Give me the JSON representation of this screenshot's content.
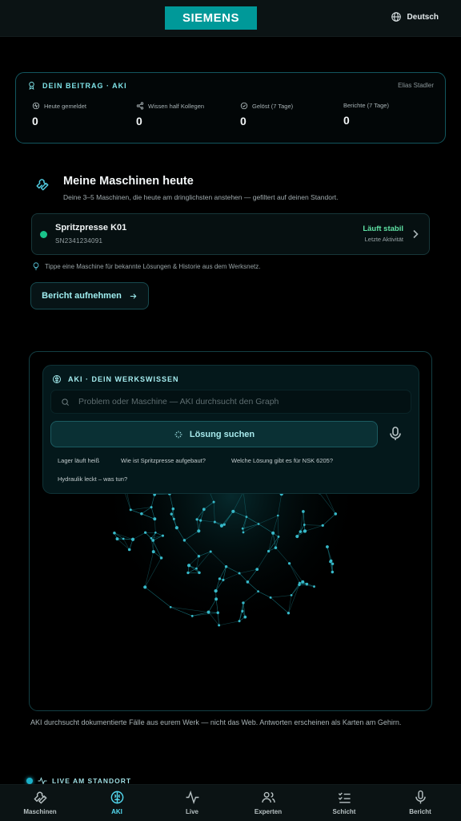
{
  "header": {
    "brand": "SIEMENS",
    "language": "Deutsch"
  },
  "contribution": {
    "title": "DEIN BEITRAG · AKI",
    "user": "Elias Stadler",
    "stats": [
      {
        "label": "Heute gemeldet",
        "value": "0",
        "icon": "heartbeat-icon"
      },
      {
        "label": "Wissen half Kollegen",
        "value": "0",
        "icon": "share-icon"
      },
      {
        "label": "Gelöst (7 Tage)",
        "value": "0",
        "icon": "check-circle-icon"
      },
      {
        "label": "Berichte (7 Tage)",
        "value": "0",
        "icon": "none"
      }
    ]
  },
  "machines": {
    "title": "Meine Maschinen heute",
    "subtitle": "Deine 3–5 Maschinen, die heute am dringlichsten anstehen — gefiltert auf deinen Standort.",
    "items": [
      {
        "name": "Spritzpresse K01",
        "serial": "SN2341234091",
        "status": "Läuft stabil",
        "last_activity": "Letzte Aktivität",
        "status_color": "#19c38a"
      }
    ],
    "tip": "Tippe eine Maschine für bekannte Lösungen & Historie aus dem Werksnetz.",
    "report_button": "Bericht aufnehmen"
  },
  "aki": {
    "title": "AKI · DEIN WERKSWISSEN",
    "search_placeholder": "Problem oder Maschine — AKI durchsucht den Graph",
    "solve_button": "Lösung suchen",
    "suggestions": [
      "Lager läuft heiß",
      "Wie ist Spritzpresse aufgebaut?",
      "Welche Lösung gibt es für NSK 6205?",
      "Hydraulik leckt – was tun?"
    ],
    "note": "AKI durchsucht dokumentierte Fälle aus eurem Werk — nicht das Web. Antworten erscheinen als Karten am Gehirn."
  },
  "live": {
    "label": "LIVE AM STANDORT"
  },
  "nav": {
    "items": [
      {
        "label": "Maschinen",
        "icon": "wrench-icon"
      },
      {
        "label": "AKI",
        "icon": "brain-icon",
        "active": true
      },
      {
        "label": "Live",
        "icon": "pulse-icon"
      },
      {
        "label": "Experten",
        "icon": "users-icon"
      },
      {
        "label": "Schicht",
        "icon": "checklist-icon"
      },
      {
        "label": "Bericht",
        "icon": "mic-icon"
      }
    ]
  },
  "colors": {
    "accent": "#009999",
    "highlight": "#53d9f0",
    "ok": "#5fe3a5"
  }
}
